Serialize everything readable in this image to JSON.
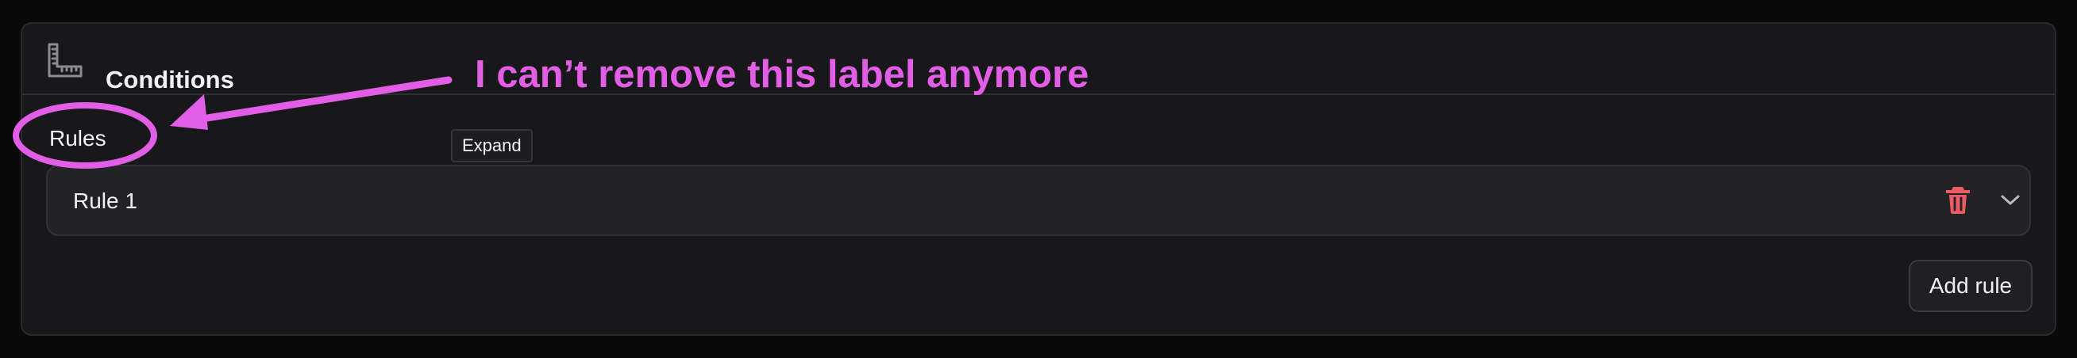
{
  "colors": {
    "page_background": "#0a0a0b",
    "panel_background": "#18181a",
    "row_background": "#232326",
    "text": "#f2f2f4",
    "muted_icon": "#8b8b92",
    "danger": "#ef5b63",
    "annotation": "#e35ee7"
  },
  "conditions": {
    "title": "Conditions",
    "icon": "ruler-icon",
    "rules_label": "Rules",
    "tooltip": "Expand",
    "rules": [
      {
        "title": "Rule 1",
        "delete_icon": "trash-icon",
        "expand_icon": "chevron-down-icon"
      }
    ],
    "add_rule_label": "Add rule"
  },
  "annotation": {
    "text": "I can’t remove this label anymore",
    "shapes": [
      "circle",
      "arrow"
    ]
  }
}
